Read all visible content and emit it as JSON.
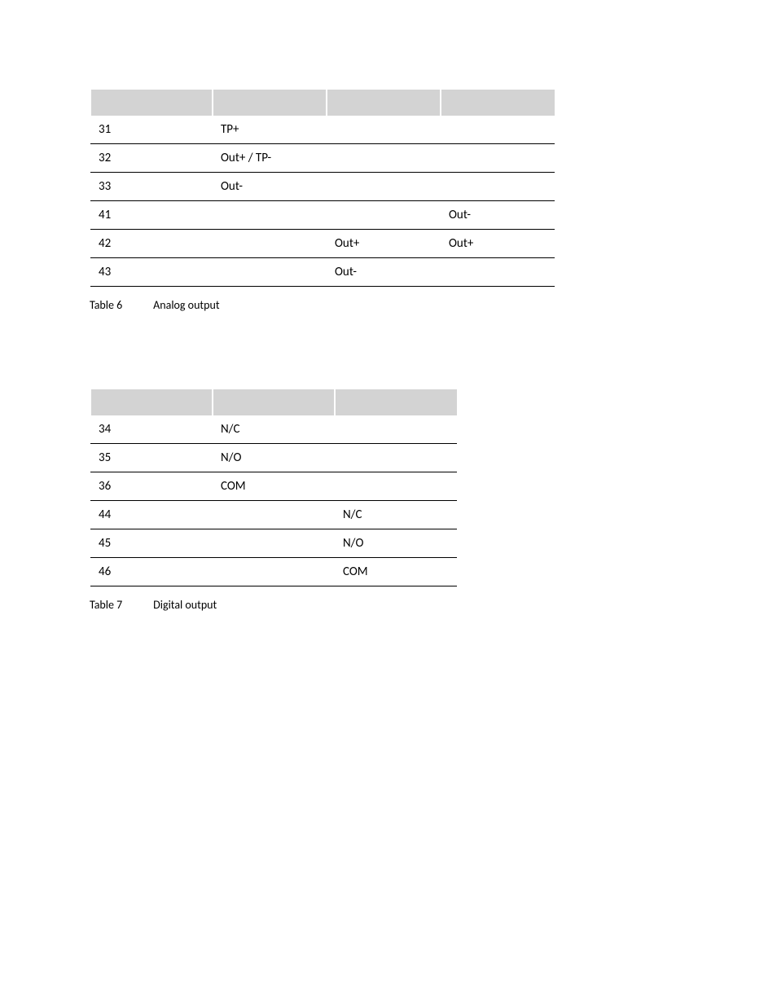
{
  "table6": {
    "caption_num": "Table 6",
    "caption_text": "Analog output",
    "rows": [
      {
        "pin": "31",
        "c1": "TP+",
        "c2": "",
        "c3": ""
      },
      {
        "pin": "32",
        "c1": "Out+ / TP-",
        "c2": "",
        "c3": ""
      },
      {
        "pin": "33",
        "c1": "Out-",
        "c2": "",
        "c3": ""
      },
      {
        "pin": "41",
        "c1": "",
        "c2": "",
        "c3": "Out-"
      },
      {
        "pin": "42",
        "c1": "",
        "c2": "Out+",
        "c3": "Out+"
      },
      {
        "pin": "43",
        "c1": "",
        "c2": "Out-",
        "c3": ""
      }
    ]
  },
  "table7": {
    "caption_num": "Table 7",
    "caption_text": "Digital output",
    "rows": [
      {
        "pin": "34",
        "c1": "N/C",
        "c2": ""
      },
      {
        "pin": "35",
        "c1": "N/O",
        "c2": ""
      },
      {
        "pin": "36",
        "c1": "COM",
        "c2": ""
      },
      {
        "pin": "44",
        "c1": "",
        "c2": "N/C"
      },
      {
        "pin": "45",
        "c1": "",
        "c2": "N/O"
      },
      {
        "pin": "46",
        "c1": "",
        "c2": "COM"
      }
    ]
  }
}
